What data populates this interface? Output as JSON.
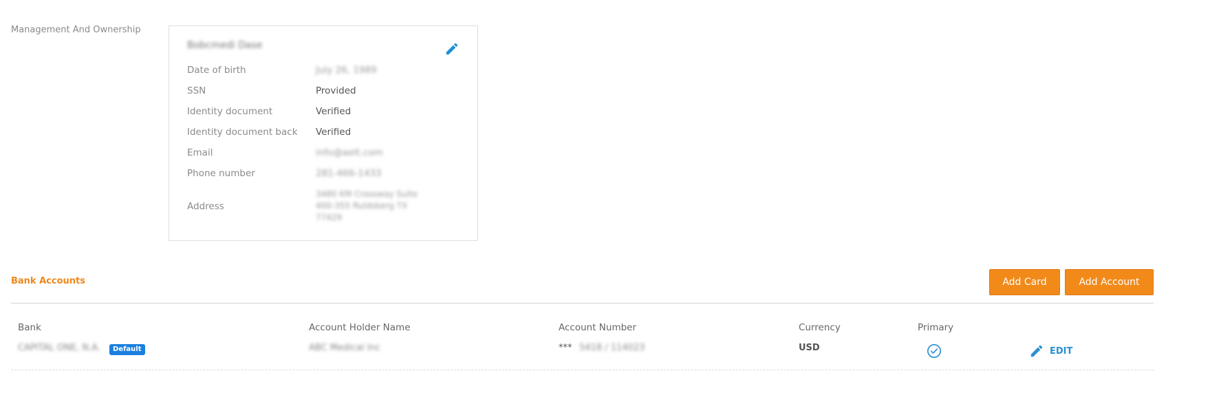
{
  "management": {
    "section_label": "Management And Ownership",
    "owner_name": "Bobcmedi Dase",
    "fields": {
      "dob_label": "Date of birth",
      "dob_value": "July 26, 1989",
      "ssn_label": "SSN",
      "ssn_value": "Provided",
      "id_doc_label": "Identity document",
      "id_doc_value": "Verified",
      "id_back_label": "Identity document back",
      "id_back_value": "Verified",
      "email_label": "Email",
      "email_value": "info@aelt.com",
      "phone_label": "Phone number",
      "phone_value": "281-466-1433",
      "address_label": "Address",
      "address_value": "3480 KM Crossway Suite 400-355 Ruldsberg TX 77429"
    }
  },
  "bank": {
    "title": "Bank Accounts",
    "add_card_label": "Add Card",
    "add_account_label": "Add Account",
    "columns": {
      "bank": "Bank",
      "holder": "Account Holder Name",
      "number": "Account Number",
      "currency": "Currency",
      "primary": "Primary"
    },
    "row": {
      "bank_name": "CAPITAL ONE, N.A.",
      "default_badge": "Default",
      "holder_name": "ABC Medical Inc",
      "account_stars": "***",
      "account_rest": "5418 / 114023",
      "currency": "USD",
      "is_primary": true,
      "edit_label": "EDIT"
    }
  },
  "colors": {
    "accent_orange": "#f28a1a",
    "link_blue": "#2a8fd4",
    "badge_blue": "#1a7fdf"
  }
}
